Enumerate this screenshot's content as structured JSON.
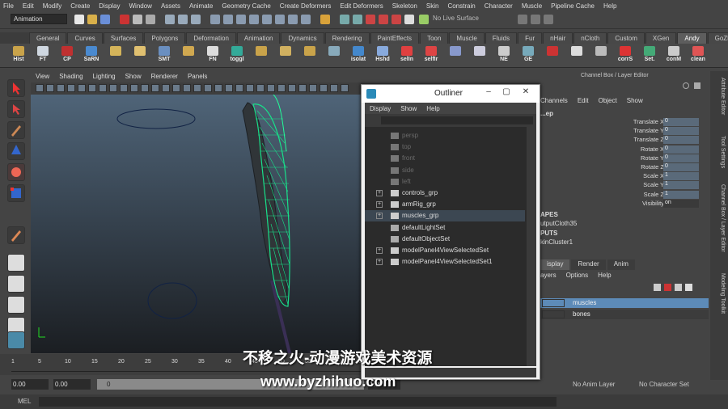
{
  "menubar": [
    "File",
    "Edit",
    "Modify",
    "Create",
    "Display",
    "Window",
    "Assets",
    "Animate",
    "Geometry Cache",
    "Create Deformers",
    "Edit Deformers",
    "Skeleton",
    "Skin",
    "Constrain",
    "Character",
    "Muscle",
    "Pipeline Cache",
    "Help"
  ],
  "status": {
    "mode": "Animation",
    "live_surface": "No Live Surface"
  },
  "shelf_tabs": [
    "General",
    "Curves",
    "Surfaces",
    "Polygons",
    "Deformation",
    "Animation",
    "Dynamics",
    "Rendering",
    "PaintEffects",
    "Toon",
    "Muscle",
    "Fluids",
    "Fur",
    "nHair",
    "nCloth",
    "Custom",
    "XGen",
    "Andy",
    "GoZBrush"
  ],
  "shelf_active": "Andy",
  "shelf_buttons": [
    "Hist",
    "FT",
    "CP",
    "SaRN",
    "",
    "",
    "SMT",
    "",
    "FN",
    "toggl",
    "",
    "",
    "",
    "",
    "isolat",
    "Hshd",
    "selIn",
    "selfIr",
    "",
    "",
    "NE",
    "GE",
    "",
    "",
    "",
    "corrS",
    "Set.",
    "conM",
    "clean"
  ],
  "panel_menu": [
    "View",
    "Shading",
    "Lighting",
    "Show",
    "Renderer",
    "Panels"
  ],
  "outliner": {
    "title": "Outliner",
    "menus": [
      "Display",
      "Show",
      "Help"
    ],
    "items": [
      {
        "label": "persp",
        "dim": true,
        "expand": false
      },
      {
        "label": "top",
        "dim": true,
        "expand": false
      },
      {
        "label": "front",
        "dim": true,
        "expand": false
      },
      {
        "label": "side",
        "dim": true,
        "expand": false
      },
      {
        "label": "left",
        "dim": true,
        "expand": false
      },
      {
        "label": "controls_grp",
        "dim": false,
        "expand": true
      },
      {
        "label": "armRig_grp",
        "dim": false,
        "expand": true
      },
      {
        "label": "muscles_grp",
        "dim": false,
        "expand": true,
        "selected": true
      },
      {
        "label": "defaultLightSet",
        "dim": false,
        "expand": false
      },
      {
        "label": "defaultObjectSet",
        "dim": false,
        "expand": false
      },
      {
        "label": "modelPanel4ViewSelectedSet",
        "dim": false,
        "expand": true
      },
      {
        "label": "modelPanel4ViewSelectedSet1",
        "dim": false,
        "expand": true
      }
    ]
  },
  "channel_box": {
    "header": "Channel Box / Layer Editor",
    "menus": [
      "Channels",
      "Edit",
      "Object",
      "Show"
    ],
    "object": "...ep",
    "attrs": [
      {
        "name": "Translate X",
        "value": "0"
      },
      {
        "name": "Translate Y",
        "value": "0"
      },
      {
        "name": "Translate Z",
        "value": "0"
      },
      {
        "name": "Rotate X",
        "value": "0"
      },
      {
        "name": "Rotate Y",
        "value": "0"
      },
      {
        "name": "Rotate Z",
        "value": "0"
      },
      {
        "name": "Scale X",
        "value": "1"
      },
      {
        "name": "Scale Y",
        "value": "1"
      },
      {
        "name": "Scale Z",
        "value": "1"
      },
      {
        "name": "Visibility",
        "value": "on"
      }
    ],
    "shapes_header": "APES",
    "shapes_item": "utputCloth35",
    "inputs_header": "PUTS",
    "inputs_item": "kinCluster1",
    "layer_tabs": [
      "isplay",
      "Render",
      "Anim"
    ],
    "layer_menus": [
      "ayers",
      "Options",
      "Help"
    ],
    "layers": [
      {
        "name": "muscles",
        "selected": true
      },
      {
        "name": "bones",
        "selected": false
      }
    ]
  },
  "side_tabs": [
    "Attribute Editor",
    "Tool Settings",
    "Channel Box / Layer Editor",
    "Modeling Toolkit"
  ],
  "timeline": {
    "ticks": [
      "1",
      "5",
      "10",
      "15",
      "20",
      "25",
      "30",
      "35",
      "40",
      "45",
      "50",
      "55",
      "60",
      "65",
      "70",
      "75",
      "80",
      "85",
      "90",
      "95",
      "100"
    ]
  },
  "range": {
    "start": "0.00",
    "start2": "0.00",
    "current": "0",
    "end": "1.00"
  },
  "anim_layer": "No Anim Layer",
  "character_set": "No Character Set",
  "cmd_label": "MEL",
  "watermark": {
    "line1": "不移之火-动漫游戏美术资源",
    "line2": "www.byzhihuo.com"
  }
}
